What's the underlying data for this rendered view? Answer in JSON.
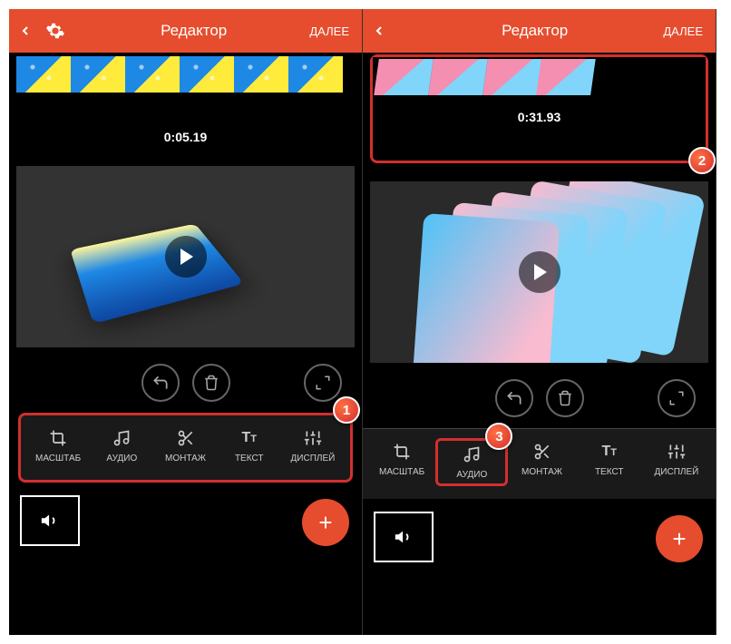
{
  "left": {
    "header": {
      "title": "Редактор",
      "next": "ДАЛЕЕ"
    },
    "timecode": "0:05.19",
    "toolbar": [
      {
        "label": "МАСШТАБ",
        "icon": "crop"
      },
      {
        "label": "АУДИО",
        "icon": "music"
      },
      {
        "label": "МОНТАЖ",
        "icon": "cut"
      },
      {
        "label": "ТЕКСТ",
        "icon": "text"
      },
      {
        "label": "ДИСПЛЕЙ",
        "icon": "sliders"
      }
    ],
    "badge": "1"
  },
  "right": {
    "header": {
      "title": "Редактор",
      "next": "ДАЛЕЕ"
    },
    "timecode": "0:31.93",
    "toolbar": [
      {
        "label": "МАСШТАБ",
        "icon": "crop"
      },
      {
        "label": "АУДИО",
        "icon": "music"
      },
      {
        "label": "МОНТАЖ",
        "icon": "cut"
      },
      {
        "label": "ТЕКСТ",
        "icon": "text"
      },
      {
        "label": "ДИСПЛЕЙ",
        "icon": "sliders"
      }
    ],
    "badge_timeline": "2",
    "badge_audio": "3"
  },
  "icons": {
    "back": "‹",
    "plus": "+"
  }
}
